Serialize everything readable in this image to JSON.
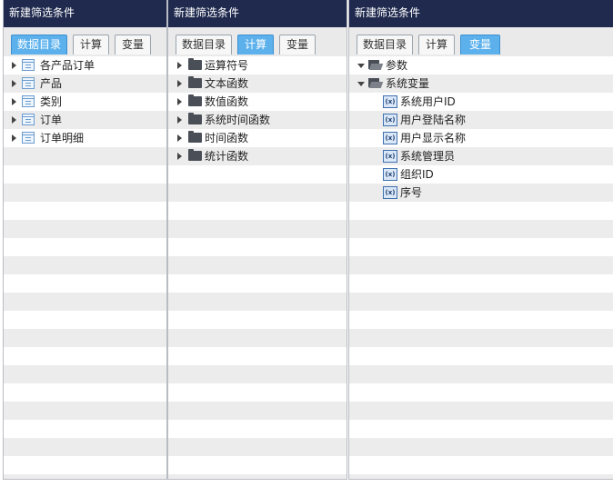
{
  "panels": [
    {
      "title": "新建筛选条件",
      "tabs": [
        "数据目录",
        "计算",
        "变量"
      ],
      "active_tab": 0,
      "items": [
        "各产品订单",
        "产品",
        "类别",
        "订单",
        "订单明细"
      ]
    },
    {
      "title": "新建筛选条件",
      "tabs": [
        "数据目录",
        "计算",
        "变量"
      ],
      "active_tab": 1,
      "items": [
        "运算符号",
        "文本函数",
        "数值函数",
        "系统时间函数",
        "时间函数",
        "统计函数"
      ]
    },
    {
      "title": "新建筛选条件",
      "tabs": [
        "数据目录",
        "计算",
        "变量"
      ],
      "active_tab": 2,
      "groups": [
        "参数",
        "系统变量"
      ],
      "variables": [
        "系统用户ID",
        "用户登陆名称",
        "用户显示名称",
        "系统管理员",
        "组织ID",
        "序号"
      ],
      "variable_icon_text": "(x)"
    }
  ],
  "colors": {
    "header_bg": "#1f2a4e",
    "active_tab": "#5cb1ec"
  },
  "icons": {
    "table": "table-icon",
    "folder": "folder-icon",
    "open_folder": "folder-open-icon",
    "variable": "variable-icon"
  }
}
